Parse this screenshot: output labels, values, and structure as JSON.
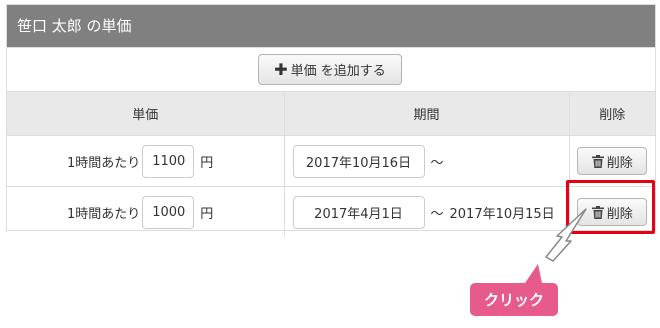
{
  "panel": {
    "title": "笹口 太郎 の単価"
  },
  "toolbar": {
    "add_icon": "plus-icon",
    "add_label": "単価 を追加する"
  },
  "table": {
    "headers": [
      "単価",
      "期間",
      "削除"
    ],
    "rows": [
      {
        "prefix": "1時間あたり",
        "price": "1100",
        "unit": "円",
        "start": "2017年10月16日",
        "tilde": "〜",
        "end": "",
        "delete_icon": "trash-icon",
        "delete_label": "削除"
      },
      {
        "prefix": "1時間あたり",
        "price": "1000",
        "unit": "円",
        "start": "2017年4月1日",
        "tilde": "〜",
        "end": "2017年10月15日",
        "delete_icon": "trash-icon",
        "delete_label": "削除"
      }
    ]
  },
  "annotation": {
    "callout_text": "クリック",
    "highlight_color": "#e60012",
    "callout_color": "#e75a8c",
    "cursor_icon": "arrow-cursor-icon"
  }
}
